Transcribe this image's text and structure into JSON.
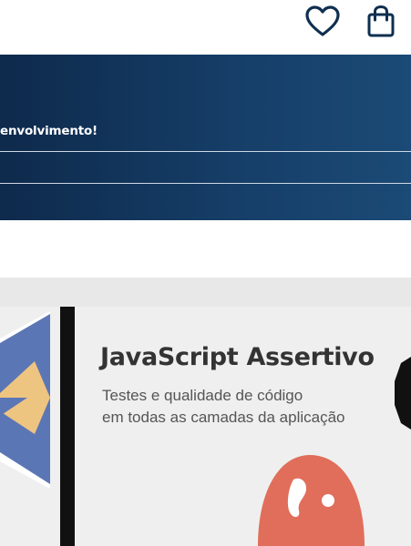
{
  "header": {
    "favorites_icon": "heart-icon",
    "cart_icon": "shopping-bag-icon"
  },
  "banner": {
    "headline": "envolvimento!",
    "color": "#163f69"
  },
  "book_cover": {
    "title": "JavaScript Assertivo",
    "subtitle_line1": "Testes e qualidade de código",
    "subtitle_line2": "em todas as camadas da aplicação",
    "mascot_color": "#e06e5a"
  }
}
